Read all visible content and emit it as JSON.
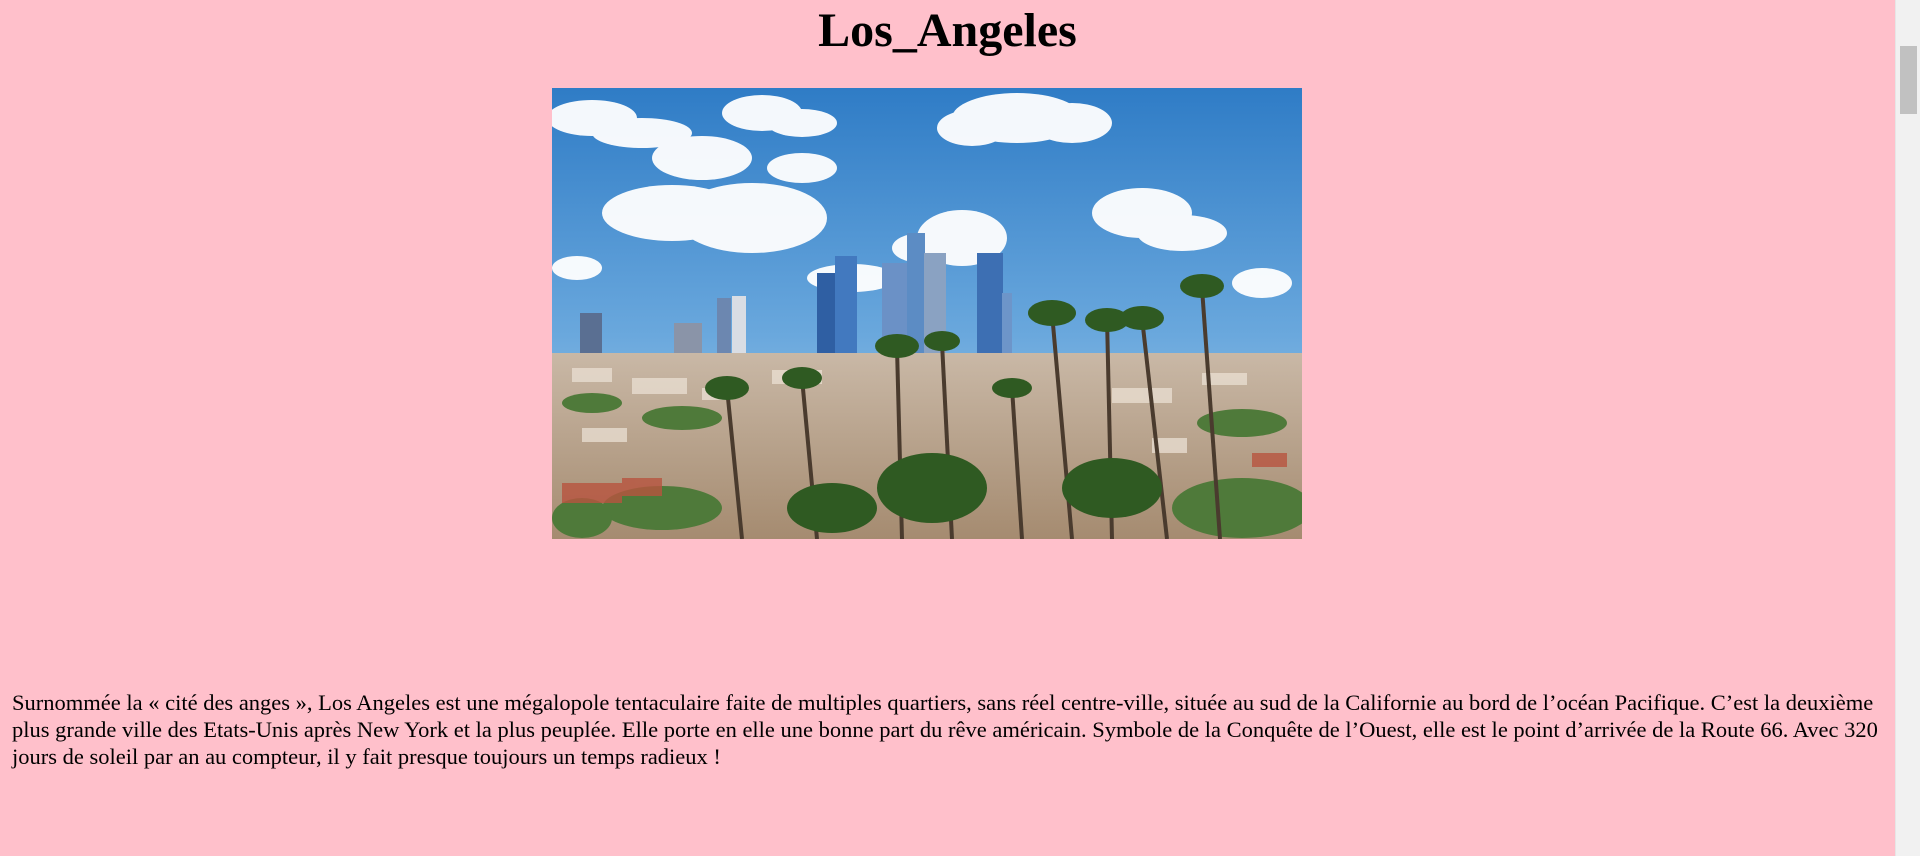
{
  "page": {
    "title": "Los_Angeles",
    "image_alt": "Los Angeles skyline with palm trees",
    "description": "Surnommée la « cité des anges », Los Angeles est une mégalopole tentaculaire faite de multiples quartiers, sans réel centre-ville, située au sud de la Californie au bord de l’océan Pacifique. C’est la deuxième plus grande ville des Etats-Unis après New York et la plus peuplée. Elle porte en elle une bonne part du rêve américain. Symbole de la Conquête de l’Ouest, elle est le point d’arrivée de la Route 66. Avec 320 jours de soleil par an au compteur, il y fait presque toujours un temps radieux !"
  },
  "colors": {
    "background": "#ffc0cb",
    "sky": "#3f86c9",
    "scrollbar_track": "#f1f1f1",
    "scrollbar_thumb": "#c1c1c1"
  }
}
